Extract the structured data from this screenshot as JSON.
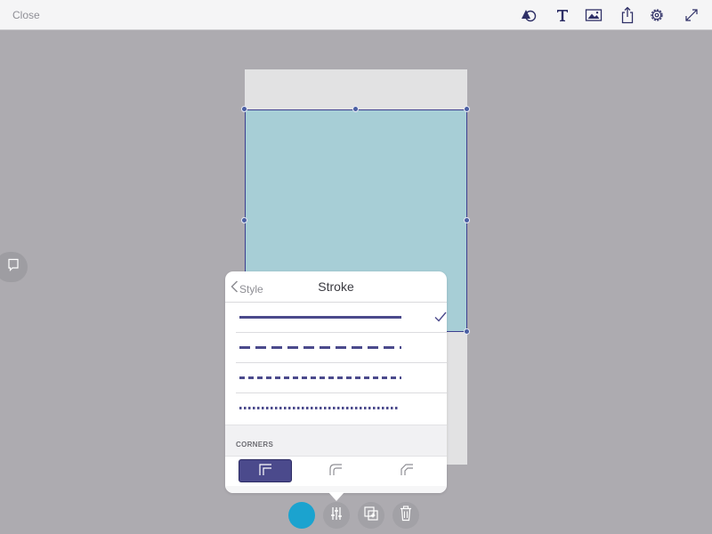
{
  "topbar": {
    "close_label": "Close",
    "icons": [
      "shapes-icon",
      "text-icon",
      "image-icon",
      "share-icon",
      "settings-icon",
      "fullscreen-icon"
    ]
  },
  "canvas": {
    "artboard_color": "#e2e2e3",
    "shape_fill": "#a7ced6",
    "shape_stroke": "#3d3f8f",
    "handle_color": "#4a5fa3"
  },
  "popover": {
    "back_label": "Style",
    "title": "Stroke",
    "stroke_styles": [
      {
        "name": "solid",
        "selected": true
      },
      {
        "name": "long-dash",
        "selected": false
      },
      {
        "name": "short-dash",
        "selected": false
      },
      {
        "name": "dotted",
        "selected": false
      }
    ],
    "stroke_color": "#4b4a8c",
    "corners_label": "CORNERS",
    "corner_styles": [
      {
        "name": "square",
        "selected": true
      },
      {
        "name": "round",
        "selected": false
      },
      {
        "name": "bevel",
        "selected": false
      }
    ]
  },
  "bottom_toolbar": {
    "color_swatch": "#1ba3cf",
    "buttons": [
      "style-adjust-icon",
      "duplicate-icon",
      "trash-icon"
    ]
  }
}
